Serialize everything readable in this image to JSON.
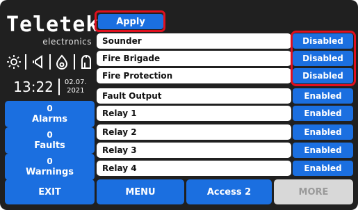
{
  "brand": {
    "name": "Teletek",
    "sub": "electronics"
  },
  "status_icons": [
    "sun-icon",
    "speaker-icon",
    "flame-icon",
    "sounder-icon"
  ],
  "clock": {
    "time": "13:22",
    "date_line1": "02.07.",
    "date_line2": "2021"
  },
  "sidebar": {
    "alarms": {
      "count": "0",
      "label": "Alarms"
    },
    "faults": {
      "count": "0",
      "label": "Faults"
    },
    "warnings": {
      "count": "0",
      "label": "Warnings"
    }
  },
  "apply_label": "Apply",
  "rows": [
    {
      "label": "Sounder",
      "status": "Disabled"
    },
    {
      "label": "Fire Brigade",
      "status": "Disabled"
    },
    {
      "label": "Fire Protection",
      "status": "Disabled"
    },
    {
      "label": "Fault Output",
      "status": "Enabled"
    },
    {
      "label": "Relay 1",
      "status": "Enabled"
    },
    {
      "label": "Relay 2",
      "status": "Enabled"
    },
    {
      "label": "Relay 3",
      "status": "Enabled"
    },
    {
      "label": "Relay 4",
      "status": "Enabled"
    }
  ],
  "bottom": {
    "exit": "EXIT",
    "menu": "MENU",
    "access": "Access 2",
    "more": "MORE"
  },
  "colors": {
    "accent": "#1b6fe0",
    "highlight": "#e0101e",
    "background": "#202020"
  }
}
